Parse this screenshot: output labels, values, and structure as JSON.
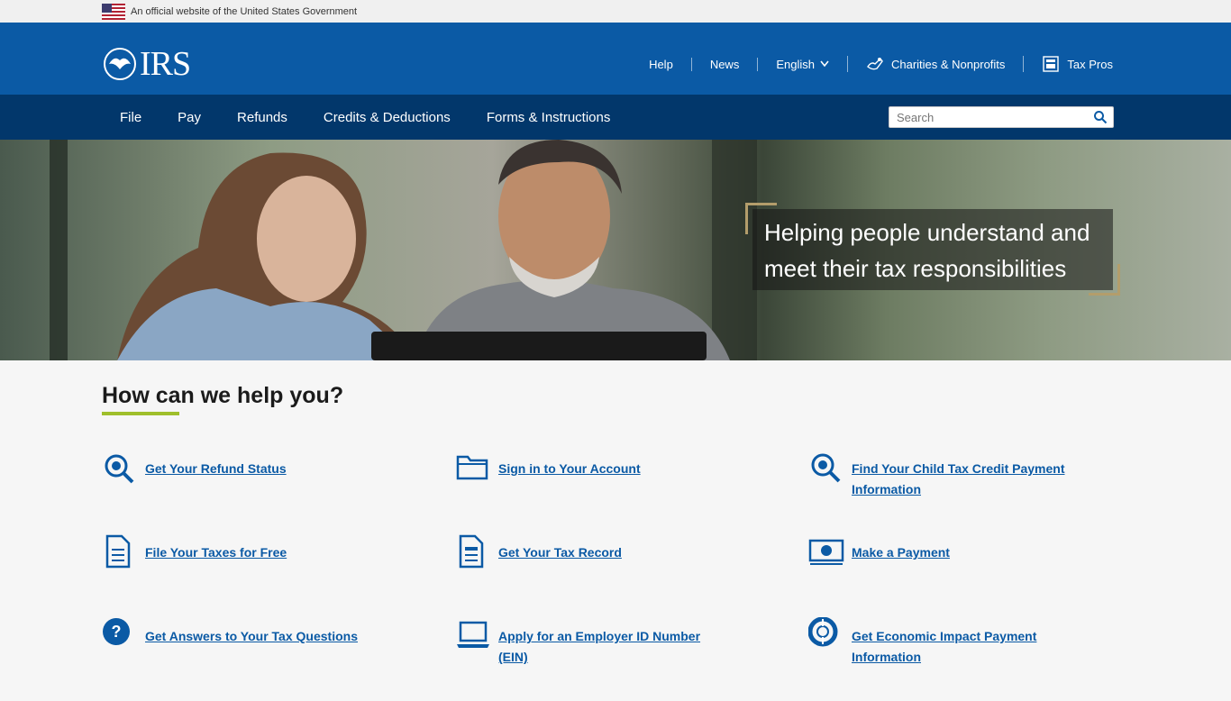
{
  "gov_banner": {
    "text": "An official website of the United States Government",
    "icon": "us-flag-icon"
  },
  "header": {
    "logo_text": "IRS",
    "utility_nav": [
      {
        "label": "Help"
      },
      {
        "label": "News"
      },
      {
        "label": "English",
        "icon": "chevron-down-icon"
      },
      {
        "label": "Charities & Nonprofits",
        "icon": "charities-icon"
      },
      {
        "label": "Tax Pros",
        "icon": "tax-pros-icon"
      }
    ]
  },
  "main_nav": {
    "tabs": [
      {
        "label": "File"
      },
      {
        "label": "Pay"
      },
      {
        "label": "Refunds"
      },
      {
        "label": "Credits & Deductions"
      },
      {
        "label": "Forms & Instructions"
      }
    ],
    "search": {
      "placeholder": "Search",
      "icon": "search-icon"
    }
  },
  "hero": {
    "tagline_line1": "Helping people understand and",
    "tagline_line2": "meet their tax responsibilities"
  },
  "help": {
    "title": "How can we help you?",
    "links": [
      {
        "label": "Get Your Refund Status",
        "icon": "refund-search-icon"
      },
      {
        "label": "Sign in to Your Account",
        "icon": "folder-icon"
      },
      {
        "label": "Find Your Child Tax Credit Payment Information",
        "icon": "search-icon"
      },
      {
        "label": "File Your Taxes for Free",
        "icon": "document-icon"
      },
      {
        "label": "Get Your Tax Record",
        "icon": "tax-record-icon"
      },
      {
        "label": "Make a Payment",
        "icon": "payment-icon"
      },
      {
        "label": "Get Answers to Your Tax Questions",
        "icon": "question-icon"
      },
      {
        "label": "Apply for an Employer ID Number (EIN)",
        "icon": "laptop-icon"
      },
      {
        "label": "Get Economic Impact Payment Information",
        "icon": "life-ring-icon"
      }
    ]
  },
  "colors": {
    "header_blue": "#0b5aa5",
    "nav_dark_blue": "#02376b",
    "accent_green": "#9fbf2b",
    "link_blue": "#0b5aa5"
  }
}
